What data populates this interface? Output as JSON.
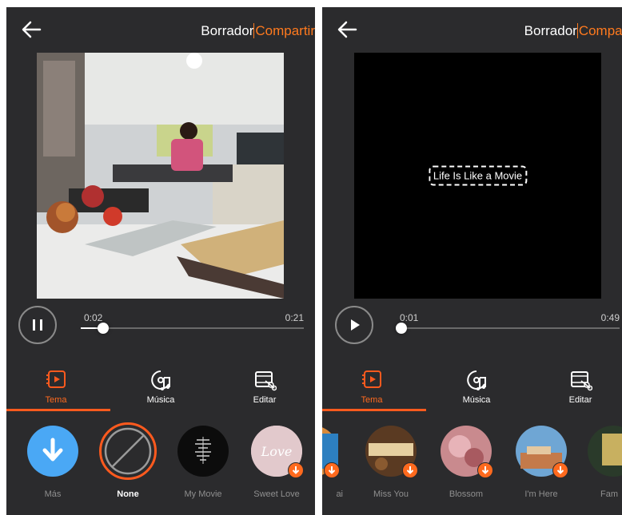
{
  "header": {
    "draft_label": "Borrador",
    "share_label": "Compartir"
  },
  "left_panel": {
    "share_label": "Compartir",
    "player": {
      "current_time": "0:02",
      "total_time": "0:21",
      "progress": 0.1,
      "state": "playing",
      "control_icon": "pause-icon"
    },
    "tabs": [
      {
        "label": "Tema",
        "icon": "theme-icon",
        "active": true
      },
      {
        "label": "Música",
        "icon": "music-icon",
        "active": false
      },
      {
        "label": "Editar",
        "icon": "edit-icon",
        "active": false
      }
    ],
    "themes": [
      {
        "label": "Más",
        "icon": "download-icon"
      },
      {
        "label": "None",
        "icon": "none-icon",
        "selected": true
      },
      {
        "label": "My Movie",
        "icon": "my-movie-icon"
      },
      {
        "label": "Sweet Love",
        "icon": "sweet-love-icon"
      }
    ],
    "sweet_love_text": "Love"
  },
  "right_panel": {
    "share_label": "Compart",
    "preview_title": "Life Is Like a Movie",
    "player": {
      "current_time": "0:01",
      "total_time": "0:49",
      "progress": 0.02,
      "state": "paused",
      "control_icon": "play-icon"
    },
    "tabs": [
      {
        "label": "Tema",
        "icon": "theme-icon",
        "active": true
      },
      {
        "label": "Música",
        "icon": "music-icon",
        "active": false
      },
      {
        "label": "Editar",
        "icon": "edit-icon",
        "active": false
      }
    ],
    "themes": [
      {
        "label": "ai"
      },
      {
        "label": "Miss You"
      },
      {
        "label": "Blossom"
      },
      {
        "label": "I'm Here"
      },
      {
        "label": "Fam"
      }
    ]
  },
  "colors": {
    "accent": "#ff6a1e",
    "background": "#2b2b2d",
    "download": "#4aa8f5"
  }
}
